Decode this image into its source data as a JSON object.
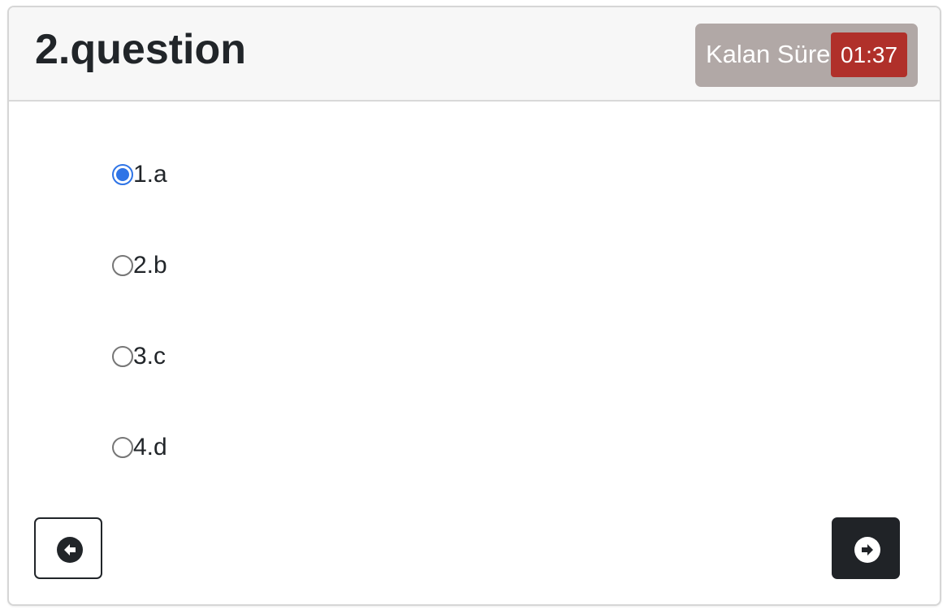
{
  "question": {
    "title": "2.question"
  },
  "timer": {
    "label": "Kalan Süre",
    "value": "01:37"
  },
  "options": [
    {
      "label": "1.a",
      "selected": true
    },
    {
      "label": "2.b",
      "selected": false
    },
    {
      "label": "3.c",
      "selected": false
    },
    {
      "label": "4.d",
      "selected": false
    }
  ],
  "navigation": {
    "previous_icon": "arrow-left-circle-icon",
    "next_icon": "arrow-right-circle-icon"
  },
  "colors": {
    "timer_box": "#b1a8a6",
    "timer_value": "#b0302a",
    "radio_selected": "#2f74e6",
    "next_button": "#202327"
  }
}
